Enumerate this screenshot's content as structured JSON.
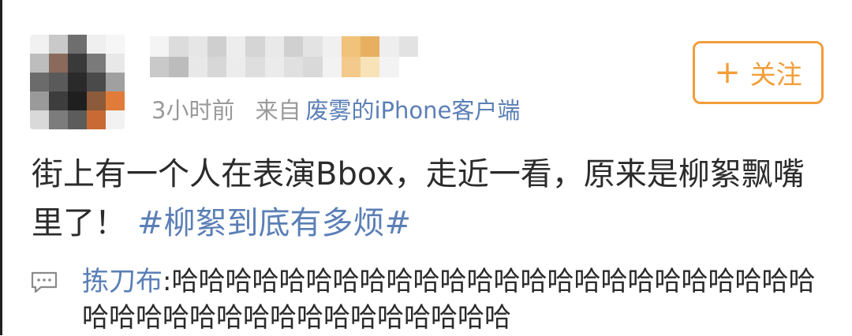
{
  "user": {
    "avatar_icon": "blurred-avatar",
    "name_icon": "blurred-username"
  },
  "meta": {
    "time": "3小时前",
    "from_label": "来自",
    "source": "废雾的iPhone客户端"
  },
  "follow_button": {
    "icon": "plus-icon",
    "plus": "+",
    "label": "关注"
  },
  "post": {
    "text": "街上有一个人在表演Bbox，走近一看，原来是柳絮飘嘴里了！",
    "hashtag": "#柳絮到底有多烦#"
  },
  "comment": {
    "icon": "comment-icon",
    "author": "拣刀布",
    "separator": ":",
    "text": "哈哈哈哈哈哈哈哈哈哈哈哈哈哈哈哈哈哈哈哈哈哈哈哈哈哈哈哈哈哈哈哈哈哈哈哈哈哈哈哈"
  },
  "colors": {
    "link": "#5b7fb6",
    "meta": "#9a9a9a",
    "follow_accent": "#f19e39",
    "text": "#2b2b2b"
  }
}
